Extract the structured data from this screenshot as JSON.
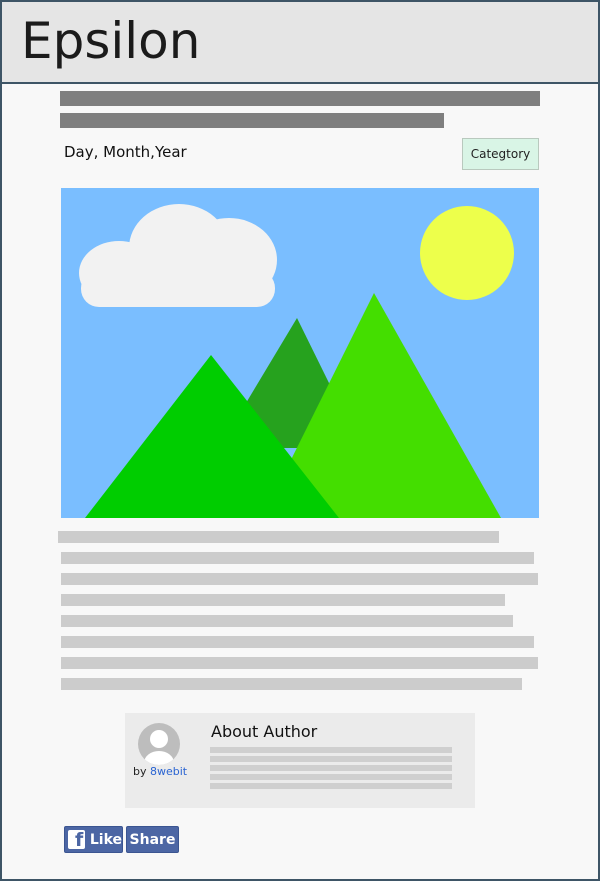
{
  "header": {
    "site_title": "Epsilon"
  },
  "article": {
    "date": "Day, Month,Year",
    "category_label": "Categtory"
  },
  "hero_image": {
    "icons": [
      "cloud-icon",
      "sun-icon",
      "mountain-icon"
    ],
    "colors": {
      "sky": "#7abeff",
      "cloud": "#f2f2f2",
      "sun": "#edff4b",
      "mountain_back": "#26a21e",
      "mountain_right": "#44de00",
      "mountain_front": "#00cd00"
    }
  },
  "author": {
    "heading": "About Author",
    "by_prefix": "by",
    "name": "8webit",
    "avatar_icon": "user-avatar-icon"
  },
  "social": {
    "like_label": "Like",
    "share_label": "Share",
    "facebook_icon": "facebook-icon",
    "brand_color": "#4c66a4"
  }
}
